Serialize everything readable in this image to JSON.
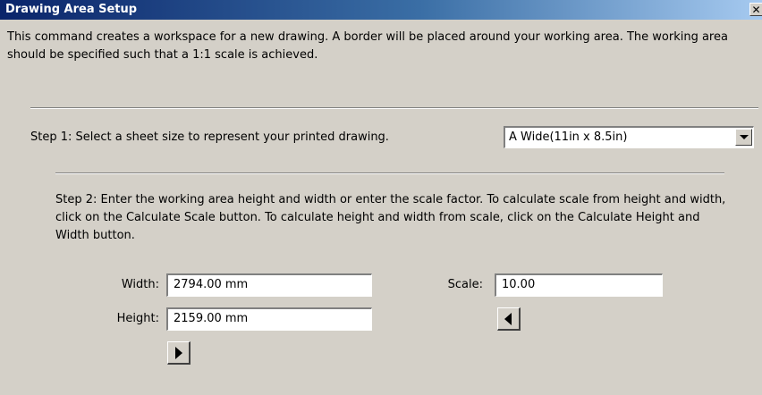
{
  "window": {
    "title": "Drawing Area Setup",
    "close_glyph": "✕"
  },
  "intro_text": "This command creates a workspace for a new drawing.  A border will be placed around your working area.  The working area should be specified such that a 1:1 scale is achieved.",
  "step1": {
    "label": "Step 1: Select a sheet size to represent your printed drawing.",
    "sheet_size_selected": "A Wide(11in x 8.5in)"
  },
  "step2": {
    "text": "Step 2: Enter the working area height and width or enter the scale factor.  To calculate scale from height and width, click on the Calculate Scale button.  To calculate height and width from scale, click on the Calculate Height and Width button.",
    "width_label": "Width:",
    "width_value": "2794.00 mm",
    "height_label": "Height:",
    "height_value": "2159.00 mm",
    "scale_label": "Scale:",
    "scale_value": "10.00"
  },
  "icons": {
    "combo_arrow": "chevron-down-icon",
    "calc_height_width": "arrow-left-icon",
    "calc_scale": "arrow-right-icon"
  }
}
